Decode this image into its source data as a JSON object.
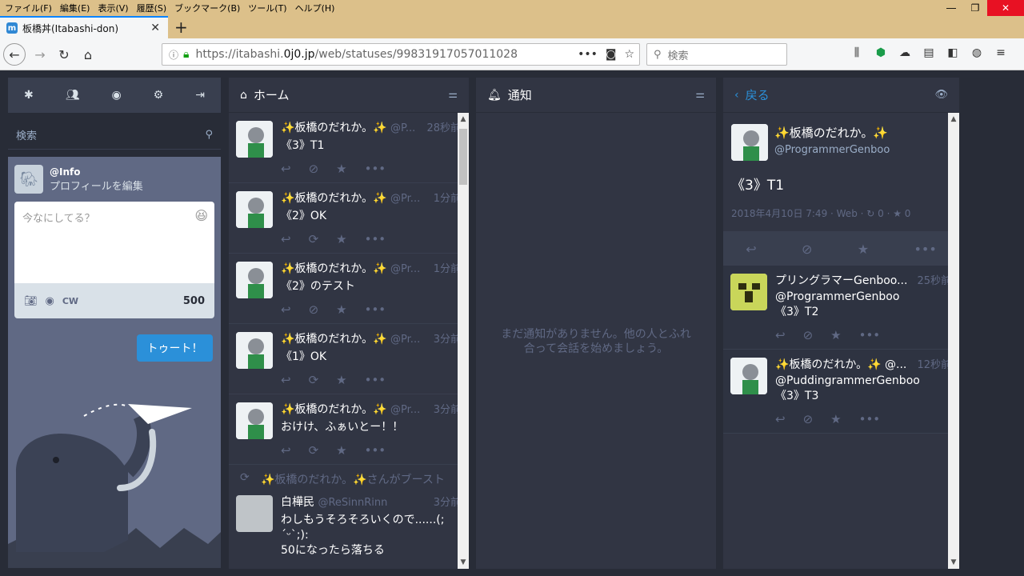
{
  "browser": {
    "menu": [
      "ファイル(F)",
      "編集(E)",
      "表示(V)",
      "履歴(S)",
      "ブックマーク(B)",
      "ツール(T)",
      "ヘルプ(H)"
    ],
    "tab_title": "板橋丼(Itabashi-don)",
    "url_prefix": "https://itabashi.",
    "url_domain": "0j0.jp",
    "url_path": "/web/statuses/99831917057011028",
    "search_placeholder": "検索",
    "favicon_glyph": "m"
  },
  "drawer": {
    "search_placeholder": "検索",
    "account_name": "@Info",
    "edit_profile": "プロフィールを編集",
    "compose_placeholder": "今なにしてる？",
    "cw_label": "CW",
    "char_count": "500",
    "toot_button": "トゥート！"
  },
  "home": {
    "title": "ホーム",
    "statuses": [
      {
        "name": "✨板橋のだれか。✨",
        "acct": "@P...",
        "time": "28秒前",
        "text": "《3》T1"
      },
      {
        "name": "✨板橋のだれか。✨",
        "acct": "@Pr...",
        "time": "1分前",
        "text": "《2》OK"
      },
      {
        "name": "✨板橋のだれか。✨",
        "acct": "@Pr...",
        "time": "1分前",
        "text": "《2》のテスト"
      },
      {
        "name": "✨板橋のだれか。✨",
        "acct": "@Pr...",
        "time": "3分前",
        "text": "《1》OK"
      },
      {
        "name": "✨板橋のだれか。✨",
        "acct": "@Pr...",
        "time": "3分前",
        "text": "おけけ、ふぁいとー！！"
      }
    ],
    "boost_note": "✨板橋のだれか。✨さんがブースト",
    "boosted": {
      "name": "白樺民",
      "acct": "@ReSinnRinn",
      "time": "3分前",
      "text1": "わしもうそろそろいくので......(;´ᵕ`;):",
      "text2": "50になったら落ちる"
    }
  },
  "notifications": {
    "title": "通知",
    "empty_text": "まだ通知がありません。他の人とふれ合って会話を始めましょう。"
  },
  "detail": {
    "back": "戻る",
    "name": "✨板橋のだれか。✨",
    "acct": "@ProgrammerGenboo",
    "content": "《3》T1",
    "meta": "2018年4月10日 7:49 · Web · ↻ 0 · ★ 0",
    "replies": [
      {
        "name": "プリングラマーGenboo...",
        "acct": "@ProgrammerGenboo",
        "time": "25秒前",
        "text": "《3》T2"
      },
      {
        "name": "✨板橋のだれか。✨ @...",
        "acct": "@PuddingrammerGenboo",
        "time": "12秒前",
        "text": "《3》T3"
      }
    ]
  },
  "colors": {
    "background": "#282c37",
    "column": "#313543",
    "accent": "#2b90d9",
    "muted": "#606984"
  }
}
